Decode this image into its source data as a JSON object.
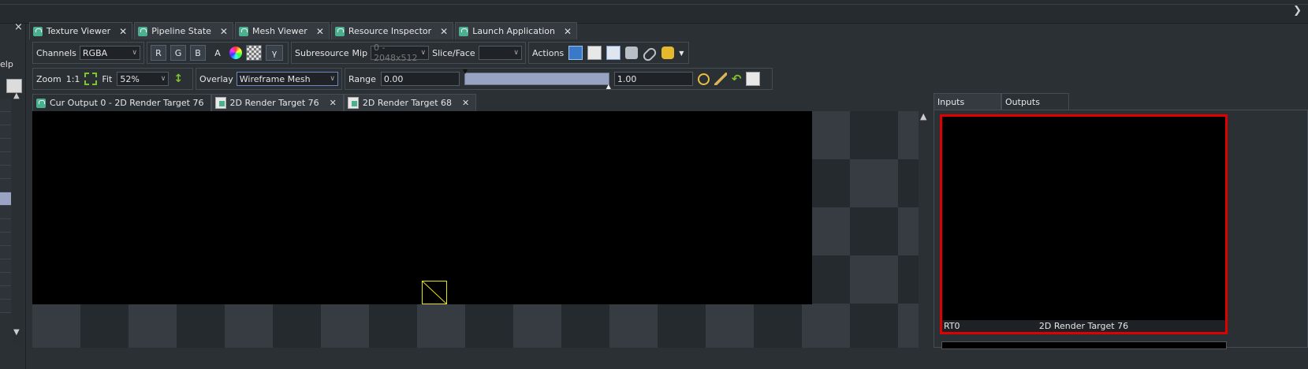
{
  "left_panel": {
    "help_text": "elp",
    "close": "×"
  },
  "tabs": [
    {
      "label": "Texture Viewer",
      "active": true
    },
    {
      "label": "Pipeline State"
    },
    {
      "label": "Mesh Viewer"
    },
    {
      "label": "Resource Inspector"
    },
    {
      "label": "Launch Application"
    }
  ],
  "toolbar1": {
    "channels_label": "Channels",
    "channels_value": "RGBA",
    "r": "R",
    "g": "G",
    "b": "B",
    "a": "A",
    "gamma": "γ",
    "subresource_label": "Subresource",
    "mip_label": "Mip",
    "mip_value": "0 - 2048x512",
    "slice_label": "Slice/Face",
    "slice_value": "",
    "actions_label": "Actions"
  },
  "toolbar2": {
    "zoom_label": "Zoom",
    "one_to_one": "1:1",
    "fit_label": "Fit",
    "zoom_value": "52%",
    "overlay_label": "Overlay",
    "overlay_value": "Wireframe Mesh",
    "range_label": "Range",
    "range_min": "0.00",
    "range_max": "1.00"
  },
  "subtabs": [
    {
      "label": "Cur Output 0 - 2D Render Target 76",
      "active": true
    },
    {
      "label": "2D Render Target 76"
    },
    {
      "label": "2D Render Target 68"
    }
  ],
  "right_panel": {
    "tabs": [
      {
        "label": "Inputs"
      },
      {
        "label": "Outputs",
        "active": true
      }
    ],
    "thumb_slot": "RT0",
    "thumb_name": "2D Render Target 76"
  },
  "colors": {
    "highlight": "#e00000",
    "wireframe": "#e6e600",
    "accent": "#4bb08d"
  }
}
